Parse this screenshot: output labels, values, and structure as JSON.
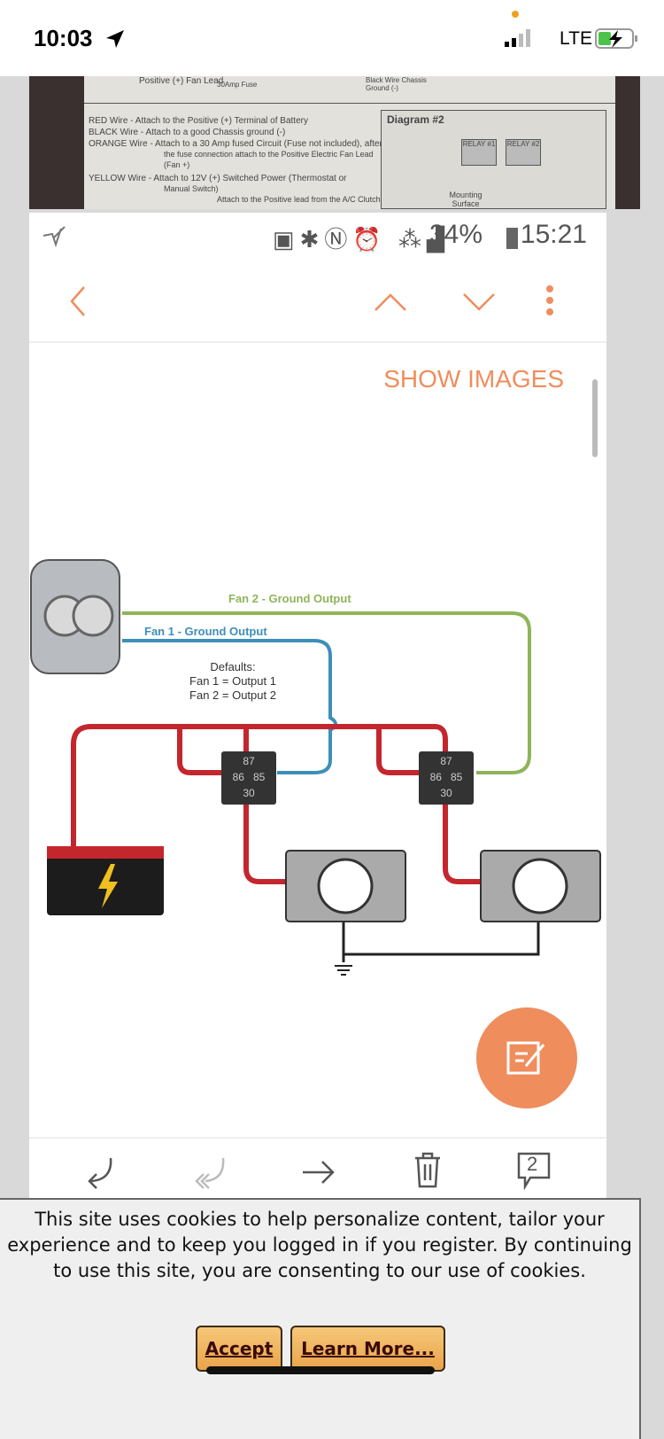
{
  "ios_status": {
    "time": "10:03",
    "network": "LTE",
    "battery_charging": true
  },
  "photo": {
    "top_labels": [
      "Positive (+) Fan Lead",
      "30Amp Fuse",
      "Black Wire Chassis Ground (-)"
    ],
    "lines": [
      "RED Wire - Attach to the Positive (+) Terminal of Battery",
      "BLACK Wire - Attach to a good Chassis ground (-)",
      "ORANGE Wire - Attach to a 30 Amp fused Circuit (Fuse not included), after",
      "the fuse connection attach to the Positive Electric Fan Lead",
      "(Fan +)",
      "YELLOW Wire - Attach to 12V (+) Switched Power (Thermostat or",
      "Manual Switch)",
      "Attach to the Positive lead from the A/C Clutch"
    ],
    "diagram_title": "Diagram #2",
    "relay1": "RELAY #1",
    "relay2": "RELAY #2",
    "mounting": "Mounting Surface"
  },
  "android_status": {
    "battery": "34%",
    "time": "15:21"
  },
  "toolbar": {
    "back": "back-icon",
    "up": "chevron-up-icon",
    "down": "chevron-down-icon",
    "more": "more-icon"
  },
  "content": {
    "show_images": "SHOW IMAGES"
  },
  "diagram": {
    "fan2": "Fan 2 - Ground Output",
    "fan1": "Fan 1 - Ground Output",
    "defaults": "Defaults:",
    "d1": "Fan 1 = Output 1",
    "d2": "Fan 2 = Output 2",
    "pins": [
      "87",
      "86",
      "85",
      "30"
    ],
    "colors": {
      "power": "#c4262e",
      "fan1": "#3d8fb8",
      "fan2": "#8fb45a",
      "ground": "#222222"
    }
  },
  "bottombar": {
    "comment_count": "2"
  },
  "accent": "#ef8d5d",
  "cookie": {
    "text": "This site uses cookies to help personalize content, tailor your experience and to keep you logged in if you register. By continuing to use this site, you are consenting to our use of cookies.",
    "accept": "Accept",
    "learn_more": "Learn More..."
  }
}
